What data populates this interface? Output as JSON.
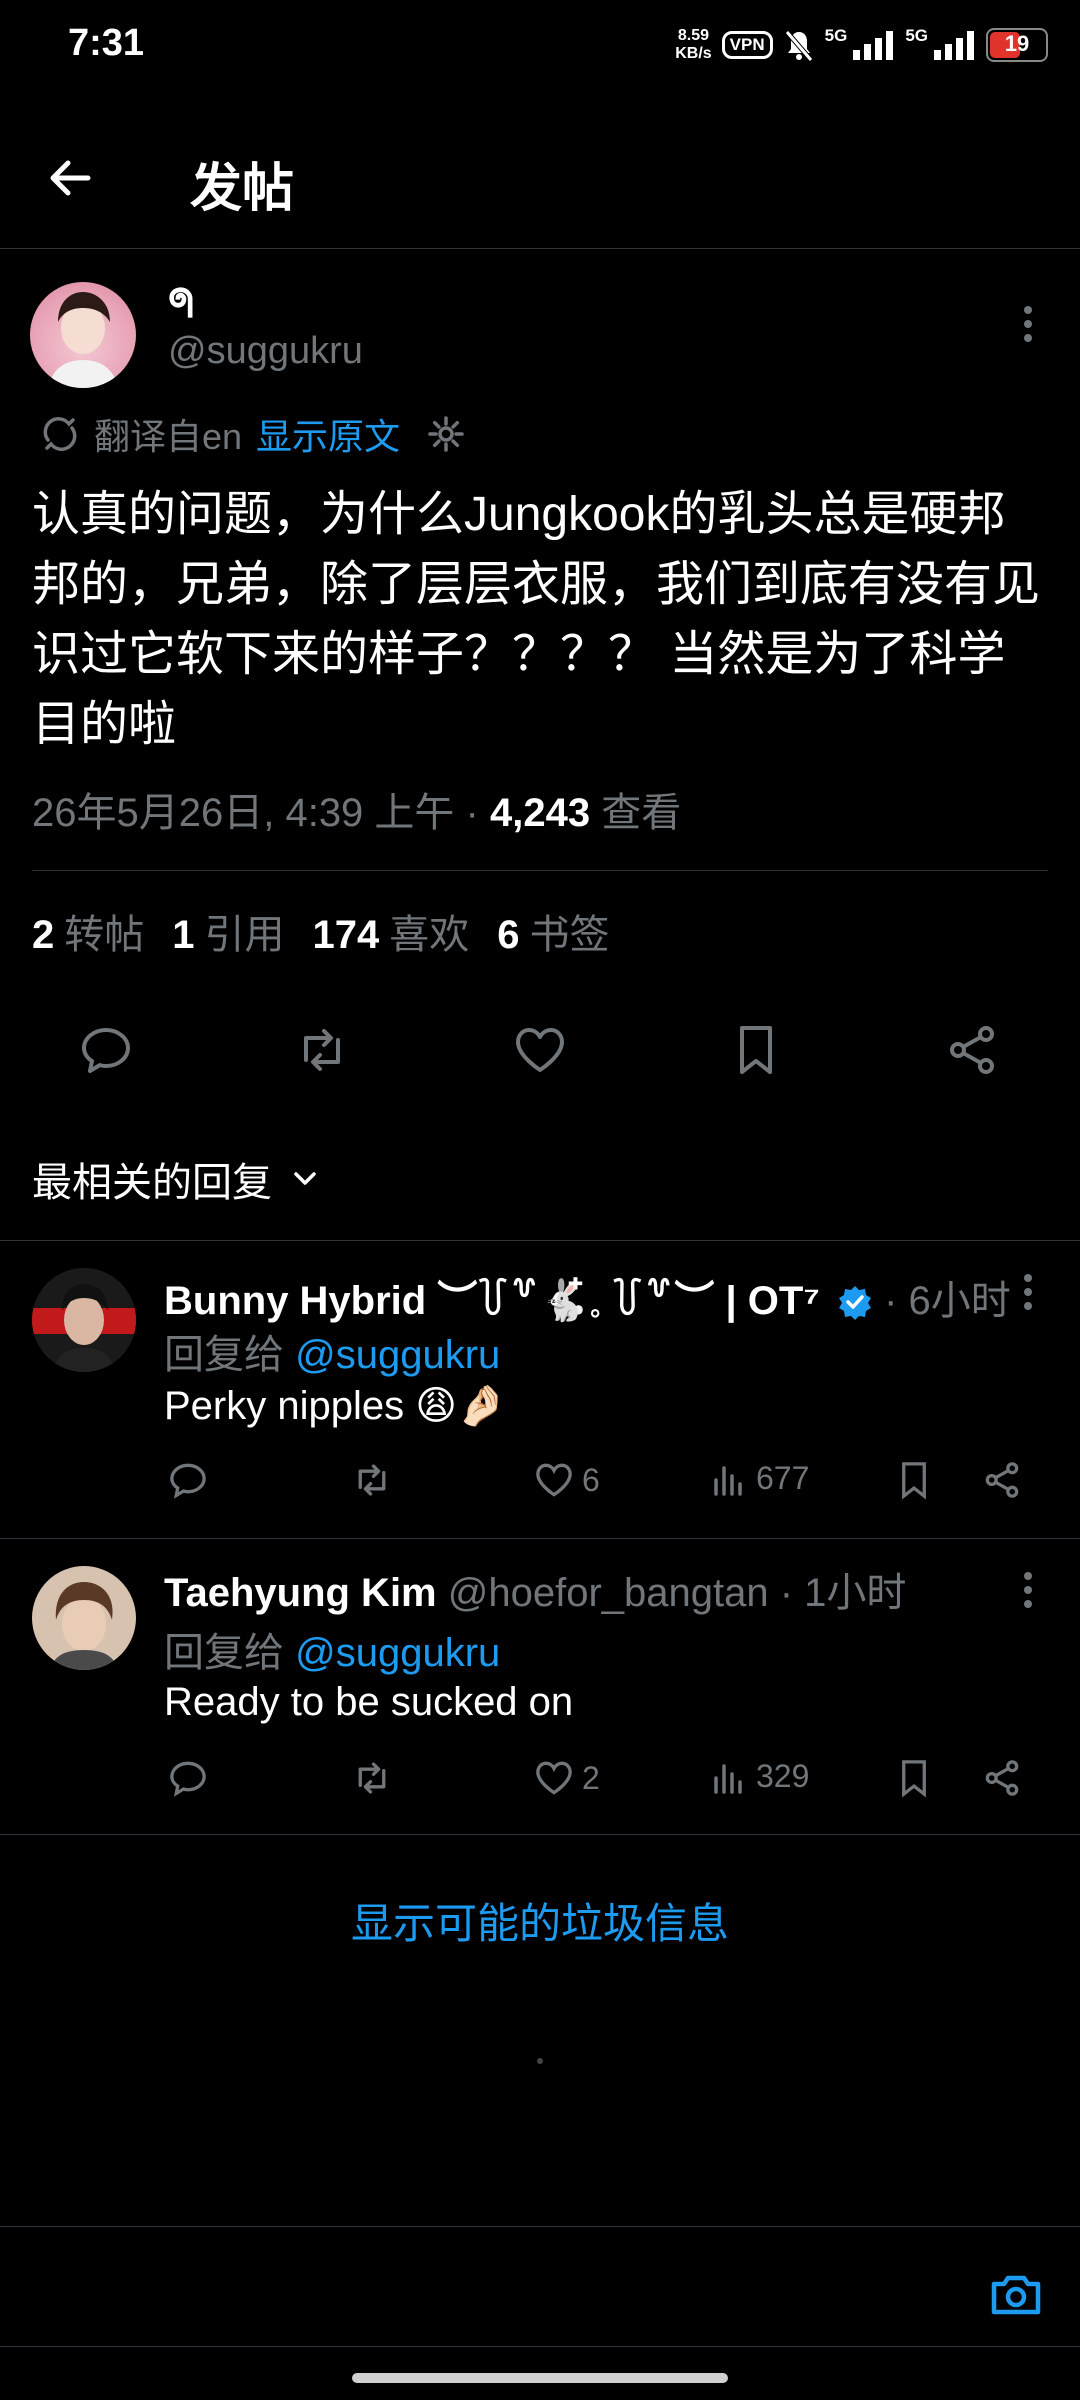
{
  "status_bar": {
    "time": "7:31",
    "net_speed_value": "8.59",
    "net_speed_unit": "KB/s",
    "vpn": "VPN",
    "sig1": "5G",
    "sig2": "5G",
    "battery": "19"
  },
  "header": {
    "title": "发帖"
  },
  "tweet": {
    "author_name": "ᖗ",
    "author_handle": "@suggukru",
    "translated_from": "翻译自en",
    "show_original": "显示原文",
    "text": "认真的问题，为什么Jungkook的乳头总是硬邦邦的，兄弟，除了层层衣服，我们到底有没有见识过它软下来的样子？？？？ 当然是为了科学目的啦",
    "date": "26年5月26日, 4:39 上午 · ",
    "views_count": "4,243",
    "views_label": " 查看",
    "stats": {
      "reposts": "2",
      "reposts_label": "转帖",
      "quotes": "1",
      "quotes_label": "引用",
      "likes": "174",
      "likes_label": "喜欢",
      "bookmarks": "6",
      "bookmarks_label": "书签"
    }
  },
  "sort": {
    "label": "最相关的回复"
  },
  "replies": [
    {
      "name": "Bunny Hybrid ︶꒦꒷🐇໋𓈒 ꒦꒷︶ | OT⁷",
      "time": " · 6小时",
      "replying_prefix": "回复给 ",
      "replying_handle": "@suggukru",
      "text": "Perky nipples 😩🤌🏻",
      "likes": "6",
      "views": "677"
    },
    {
      "name": "Taehyung Kim",
      "handle": " @hoefor_bangtan",
      "time": " · 1小时",
      "replying_prefix": "回复给 ",
      "replying_handle": "@suggukru",
      "text": "Ready to be sucked on",
      "likes": "2",
      "views": "329"
    }
  ],
  "spam_link": "显示可能的垃圾信息",
  "colors": {
    "accent": "#1d9bf0",
    "muted": "#71767b",
    "divider": "#2f3336",
    "background": "#000000"
  }
}
